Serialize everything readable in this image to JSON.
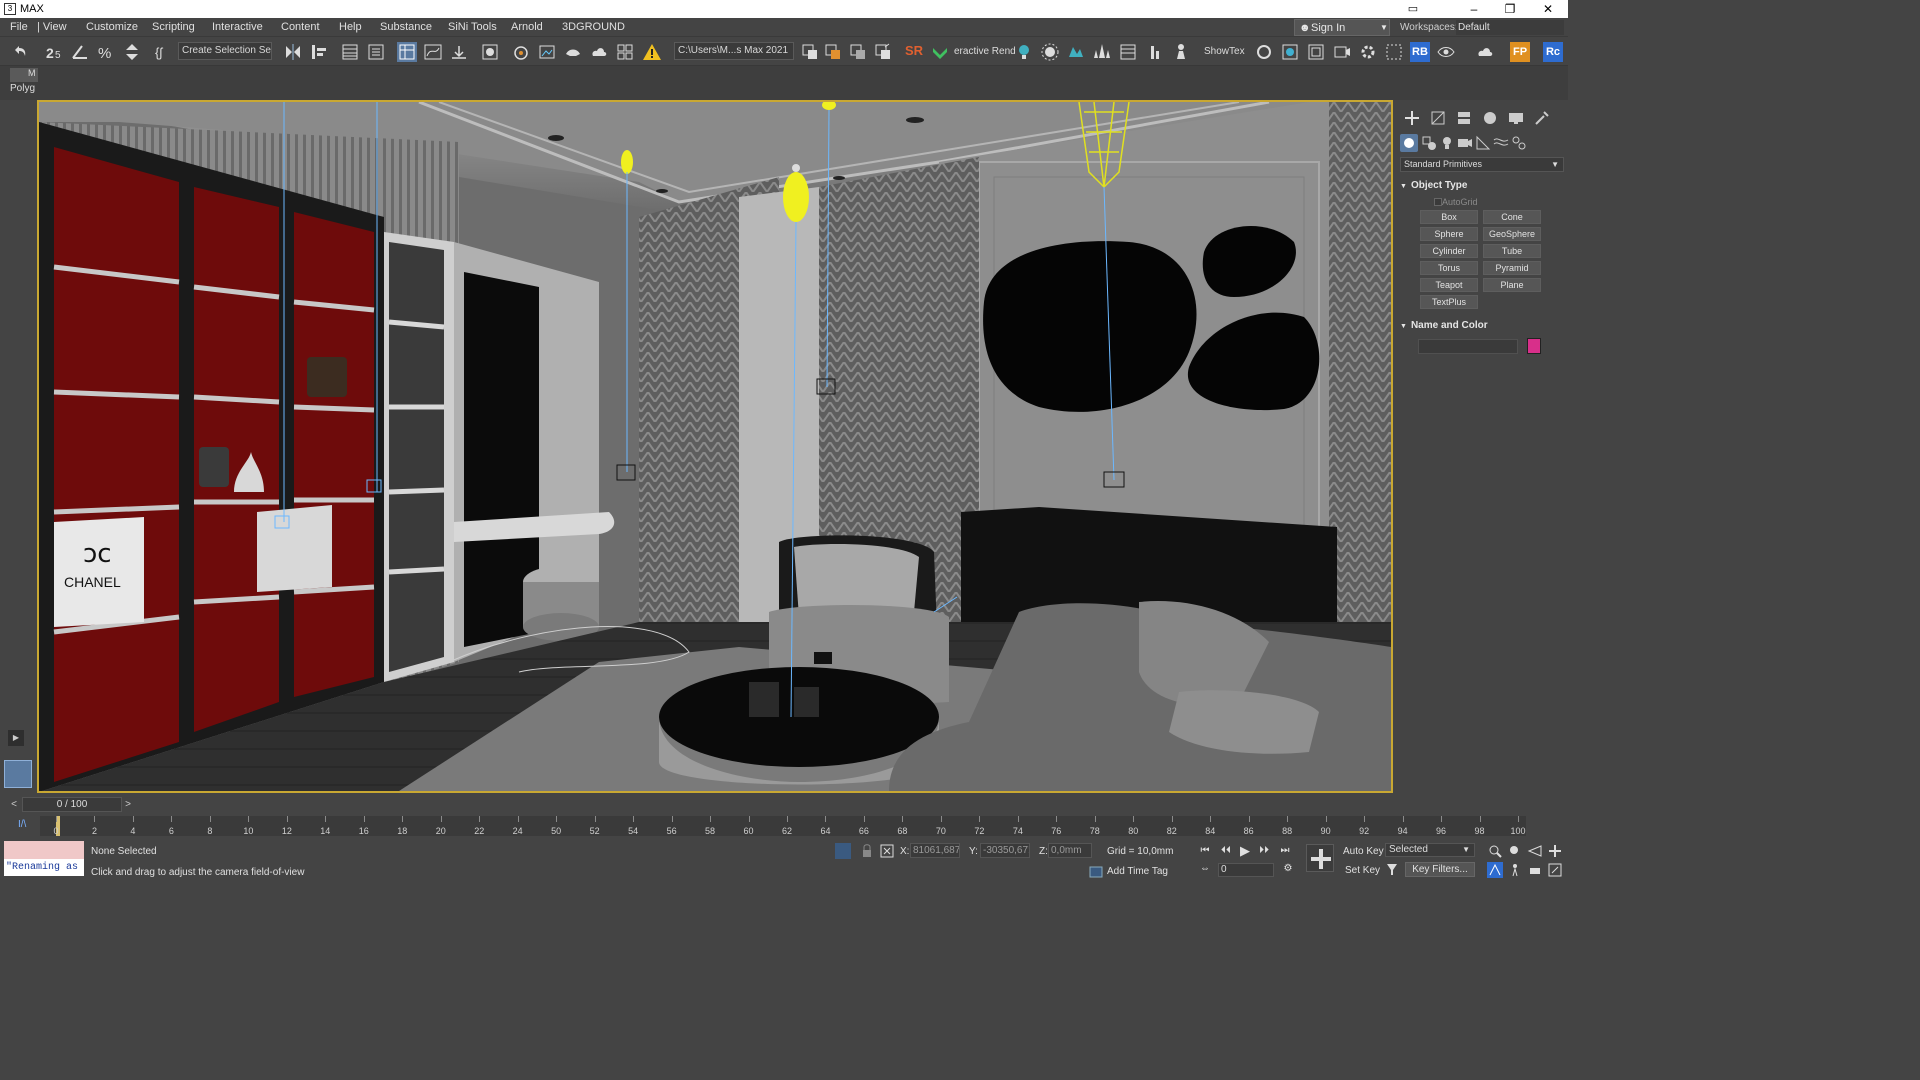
{
  "window": {
    "title": "MAX",
    "logo_text": "3",
    "minimize": "–",
    "maximize": "❐",
    "close": "✕"
  },
  "menu": {
    "items": [
      "File",
      "| View",
      "Customize",
      "Scripting",
      "Interactive",
      "Content",
      "Help",
      "Substance",
      "SiNi Tools",
      "Arnold",
      "3DGROUND"
    ],
    "sign_in": "Sign In",
    "workspaces_label": "Workspaces:",
    "workspace_value": "Default"
  },
  "toolbar": {
    "selection_set": "Create Selection Se",
    "project_path": "C:\\Users\\M...s Max 2021",
    "renderer_label": "eractive Rend",
    "sr_label": "SR",
    "rb_label": "RB",
    "fp_label": "FP",
    "rc_label": "Rc",
    "showtex_label": "ShowTex"
  },
  "ribbon": {
    "tab1": "M",
    "tab2": "Polyg"
  },
  "command_panel": {
    "category": "Standard Primitives",
    "object_type_title": "Object Type",
    "autogrid_label": "AutoGrid",
    "primitives": [
      "Box",
      "Cone",
      "Sphere",
      "GeoSphere",
      "Cylinder",
      "Tube",
      "Torus",
      "Pyramid",
      "Teapot",
      "Plane",
      "TextPlus"
    ],
    "name_color_title": "Name and Color",
    "object_color": "#d82f8a"
  },
  "viewport": {
    "bag_brand": "CHANEL",
    "active_border_color": "#c9a832"
  },
  "timeline": {
    "frame_display": "0 / 100",
    "prev": "<",
    "next": ">",
    "ticks": [
      "0",
      "2",
      "4",
      "6",
      "8",
      "10",
      "12",
      "14",
      "16",
      "18",
      "20",
      "22",
      "24",
      "50",
      "52",
      "54",
      "56",
      "58",
      "60",
      "62",
      "64",
      "66",
      "68",
      "70",
      "72",
      "74",
      "76",
      "78",
      "80",
      "82",
      "84",
      "86",
      "88",
      "90",
      "92",
      "94",
      "96",
      "98",
      "100"
    ],
    "curve_label": "I/\\"
  },
  "status": {
    "selection": "None Selected",
    "prompt": "Click and drag to adjust the camera field-of-view",
    "maxscript_text": "\"Renaming as",
    "x_label": "X:",
    "x_value": "81061,687",
    "y_label": "Y:",
    "y_value": "-30350,67!",
    "z_label": "Z:",
    "z_value": "0,0mm",
    "grid": "Grid = 10,0mm",
    "add_time_tag": "Add Time Tag",
    "frame": "0",
    "auto_key": "Auto Key",
    "set_key": "Set Key",
    "key_selection": "Selected",
    "key_filters": "Key Filters..."
  }
}
